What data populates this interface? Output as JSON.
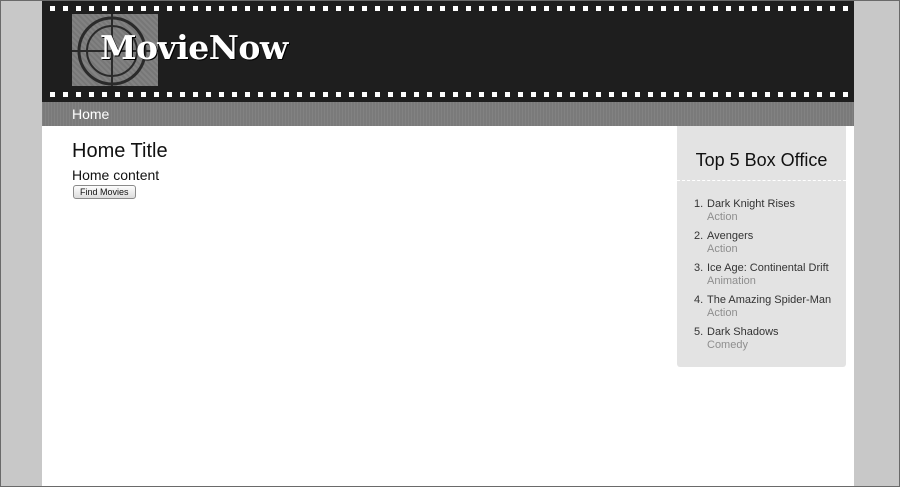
{
  "header": {
    "logo_text": "MovieNow"
  },
  "nav": {
    "items": [
      {
        "label": "Home"
      }
    ]
  },
  "main": {
    "title": "Home Title",
    "content": "Home content",
    "find_button_label": "Find Movies"
  },
  "sidebar": {
    "title": "Top 5 Box Office",
    "movies": [
      {
        "rank": "1.",
        "title": "Dark Knight Rises",
        "genre": "Action"
      },
      {
        "rank": "2.",
        "title": "Avengers",
        "genre": "Action"
      },
      {
        "rank": "3.",
        "title": "Ice Age: Continental Drift",
        "genre": "Animation"
      },
      {
        "rank": "4.",
        "title": "The Amazing Spider-Man",
        "genre": "Action"
      },
      {
        "rank": "5.",
        "title": "Dark Shadows",
        "genre": "Comedy"
      }
    ]
  },
  "colors": {
    "header_bg": "#1e1e1e",
    "nav_bg": "#7a7a7a",
    "sidebar_bg": "#e3e3e3",
    "page_bg": "#c8c8c8"
  },
  "icons": {
    "logo_mark": "film-countdown-reel-icon"
  }
}
